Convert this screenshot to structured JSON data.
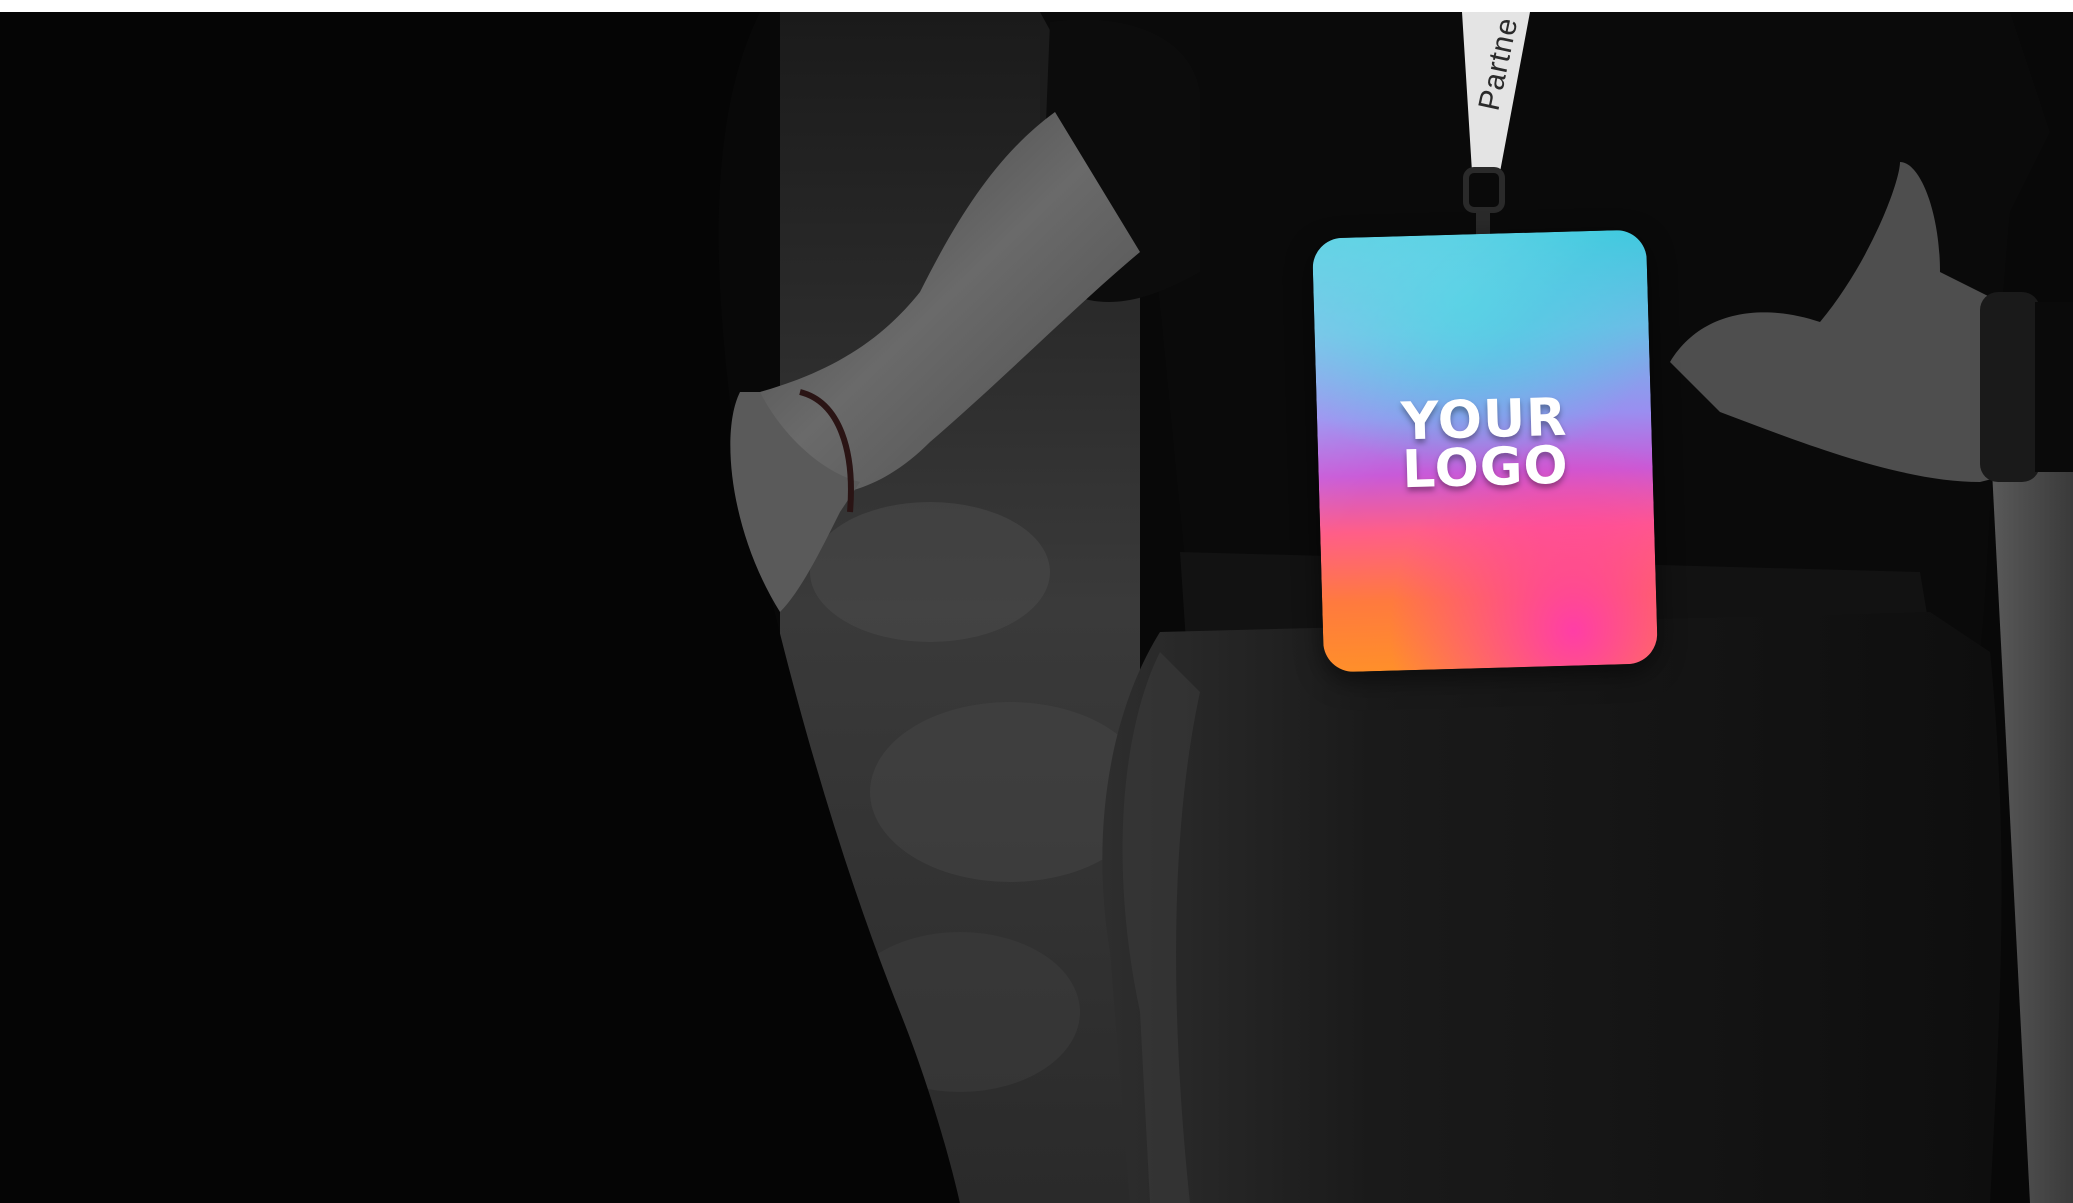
{
  "photo": {
    "lanyard_print": "Partne",
    "badge": {
      "logo_line_1": "YOUR",
      "logo_line_2": "LOGO"
    },
    "colors": {
      "background": "#080808",
      "badge_top": "#3fc9de",
      "badge_middle": "#b36ae6",
      "badge_bottom": "#ff7a3e",
      "logo_text": "#ffffff"
    }
  }
}
